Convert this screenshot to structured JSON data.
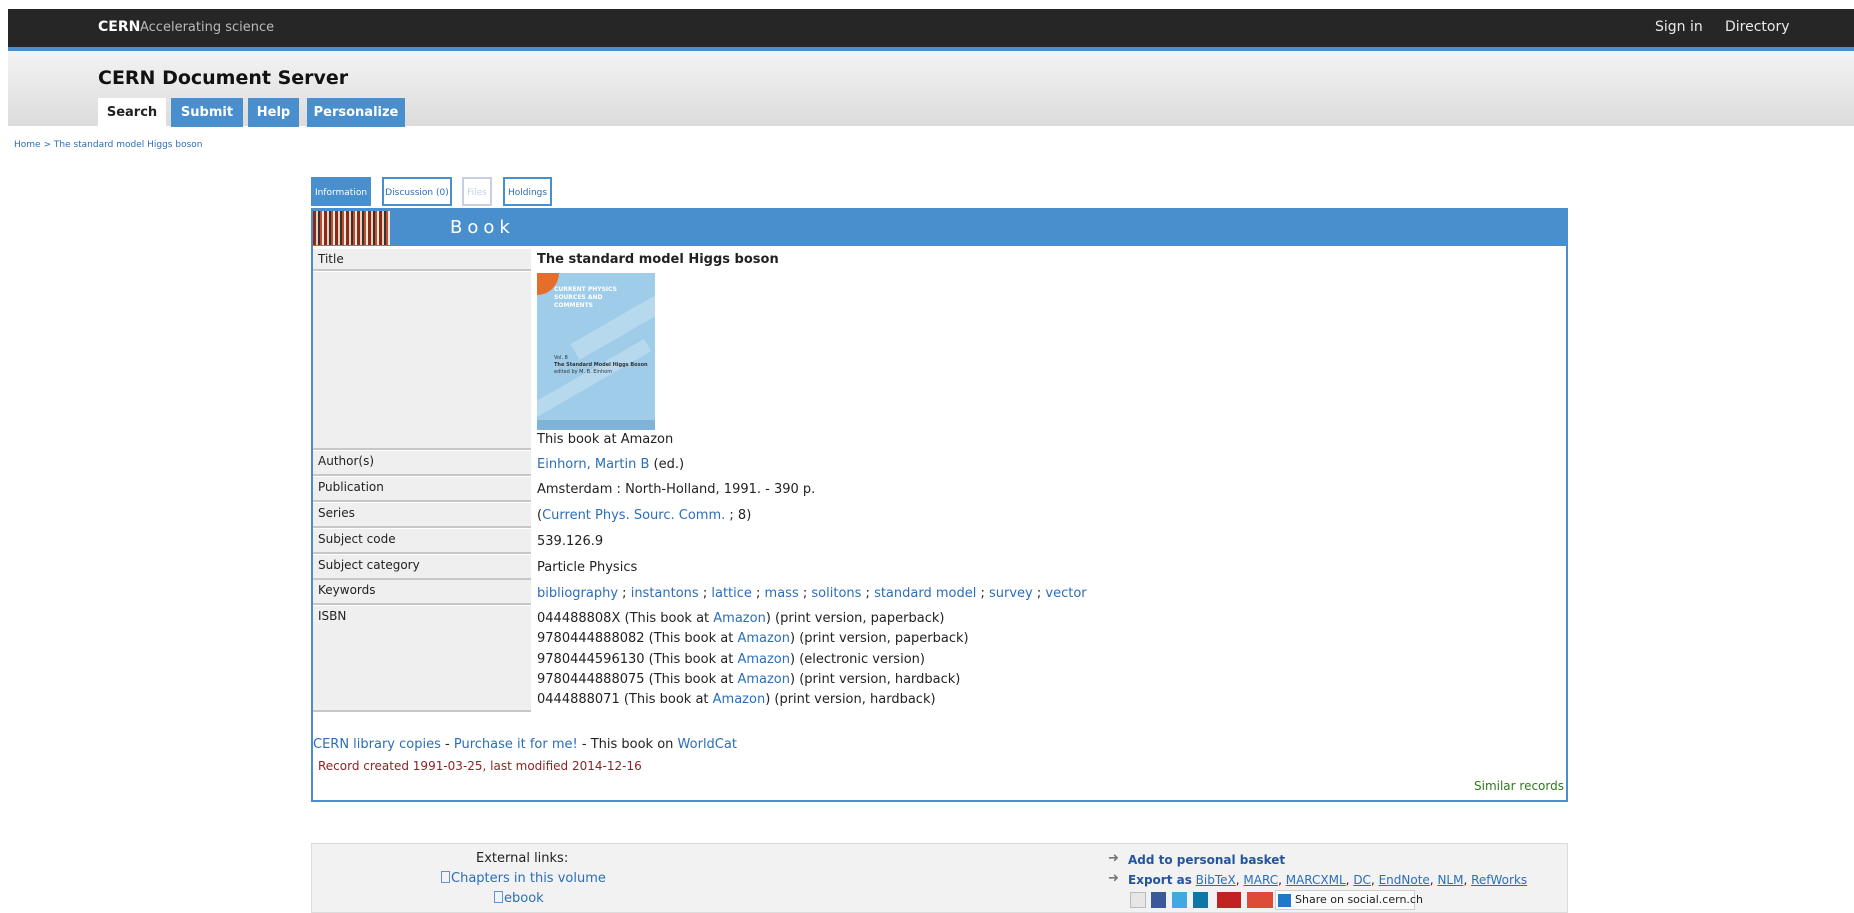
{
  "topbar": {
    "brand": "CERN",
    "tagline": "Accelerating science",
    "sign_in": "Sign in",
    "directory": "Directory"
  },
  "header": {
    "site_title": "CERN Document Server",
    "tabs": [
      {
        "label": "Search"
      },
      {
        "label": "Submit"
      },
      {
        "label": "Help"
      },
      {
        "label": "Personalize"
      }
    ]
  },
  "breadcrumb": "Home > The standard model Higgs boson",
  "record_tabs": [
    {
      "label": "Information"
    },
    {
      "label": "Discussion (0)"
    },
    {
      "label": "Files"
    },
    {
      "label": "Holdings"
    }
  ],
  "banner": {
    "label": "Book"
  },
  "record": {
    "title_label": "Title",
    "title": "The standard model Higgs boson",
    "cover": {
      "series": "CURRENT PHYSICS SOURCES AND COMMENTS",
      "volume": "Vol. 8",
      "cover_title": "The Standard Model Higgs Boson",
      "editor": "edited by M. B. Einhorn"
    },
    "amazon_link": "This book at Amazon",
    "authors_label": "Author(s)",
    "author": "Einhorn, Martin B",
    "author_role": "(ed.)",
    "publication_label": "Publication",
    "publication": "Amsterdam : North-Holland, 1991. - 390 p.",
    "series_label": "Series",
    "series_open": "(",
    "series": "Current Phys. Sourc. Comm.",
    "series_num": "; 8)",
    "subject_code_label": "Subject code",
    "subject_code": "539.126.9",
    "subject_category_label": "Subject category",
    "subject_category": "Particle Physics",
    "keywords_label": "Keywords",
    "keywords": [
      "bibliography",
      "instantons",
      "lattice",
      "mass",
      "solitons",
      "standard model",
      "survey",
      "vector"
    ],
    "keyword_sep": " ; ",
    "isbn_label": "ISBN",
    "isbn": [
      {
        "number": "044488808X",
        "pre": " (This book at ",
        "link": "Amazon",
        "post": ") (print version, paperback)"
      },
      {
        "number": "9780444888082",
        "pre": " (This book at ",
        "link": "Amazon",
        "post": ") (print version, paperback)"
      },
      {
        "number": "9780444596130",
        "pre": " (This book at ",
        "link": "Amazon",
        "post": ") (electronic version)"
      },
      {
        "number": "9780444888075",
        "pre": " (This book at ",
        "link": "Amazon",
        "post": ") (print version, hardback)"
      },
      {
        "number": "0444888071",
        "pre": " (This book at ",
        "link": "Amazon",
        "post": ") (print version, hardback)"
      }
    ]
  },
  "library_line": {
    "copies": "CERN library copies",
    "sep1": " - ",
    "purchase": "Purchase it for me!",
    "sep2": " - This book on ",
    "worldcat": "WorldCat"
  },
  "record_created": "Record created 1991-03-25, last modified 2014-12-16",
  "similar": "Similar records",
  "bottom": {
    "external_links_title": "External links:",
    "chapters": "Chapters in this volume",
    "ebook": "ebook",
    "add_basket": "Add to personal basket",
    "export_prefix": "Export as",
    "export_formats": [
      "BibTeX",
      "MARC",
      "MARCXML",
      "DC",
      "EndNote",
      "NLM",
      "RefWorks"
    ],
    "share": "Share on social.cern.ch",
    "social_icons": [
      "email-icon",
      "facebook-icon",
      "twitter-icon",
      "linkedin-icon",
      "sciencewise-icon",
      "google-plus-icon",
      "share-icon"
    ]
  },
  "colors": {
    "accent": "#4a8fcd",
    "topbar": "#262626",
    "link": "#2a6ebb",
    "record_created": "#8a2424",
    "similar": "#2d7a1c"
  }
}
